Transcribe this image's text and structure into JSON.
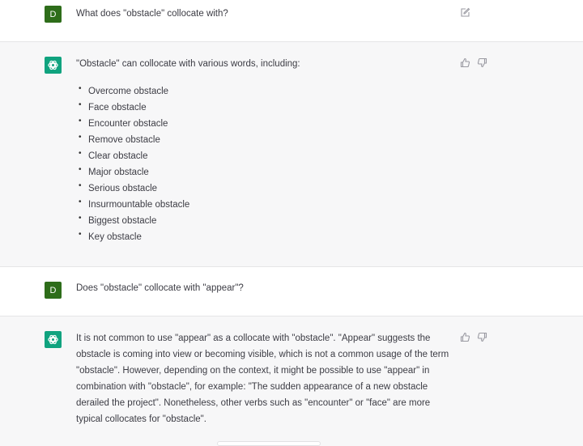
{
  "conversation": {
    "messages": [
      {
        "role": "user",
        "avatar_letter": "D",
        "text": "What does \"obstacle\" collocate with?",
        "actions": [
          "edit-icon"
        ]
      },
      {
        "role": "assistant",
        "intro": "\"Obstacle\" can collocate with various words, including:",
        "list": [
          "Overcome obstacle",
          "Face obstacle",
          "Encounter obstacle",
          "Remove obstacle",
          "Clear obstacle",
          "Major obstacle",
          "Serious obstacle",
          "Insurmountable obstacle",
          "Biggest obstacle",
          "Key obstacle"
        ],
        "actions": [
          "thumbs-up-icon",
          "thumbs-down-icon"
        ]
      },
      {
        "role": "user",
        "avatar_letter": "D",
        "text": "Does \"obstacle\" collocate with \"appear\"?",
        "actions": []
      },
      {
        "role": "assistant",
        "text": "It is not common to use \"appear\" as a collocate with \"obstacle\". \"Appear\" suggests the obstacle is coming into view or becoming visible, which is not a common usage of the term \"obstacle\". However, depending on the context, it might be possible to use \"appear\" in combination with \"obstacle\", for example: \"The sudden appearance of a new obstacle derailed the project\". Nonetheless, other verbs such as \"encounter\" or \"face\" are more typical collocates for \"obstacle\".",
        "actions": [
          "thumbs-up-icon",
          "thumbs-down-icon"
        ]
      }
    ]
  },
  "colors": {
    "user_avatar": "#2e6d1a",
    "assistant_avatar": "#10a37f",
    "user_bg": "#ffffff",
    "assistant_bg": "#f7f7f8"
  }
}
